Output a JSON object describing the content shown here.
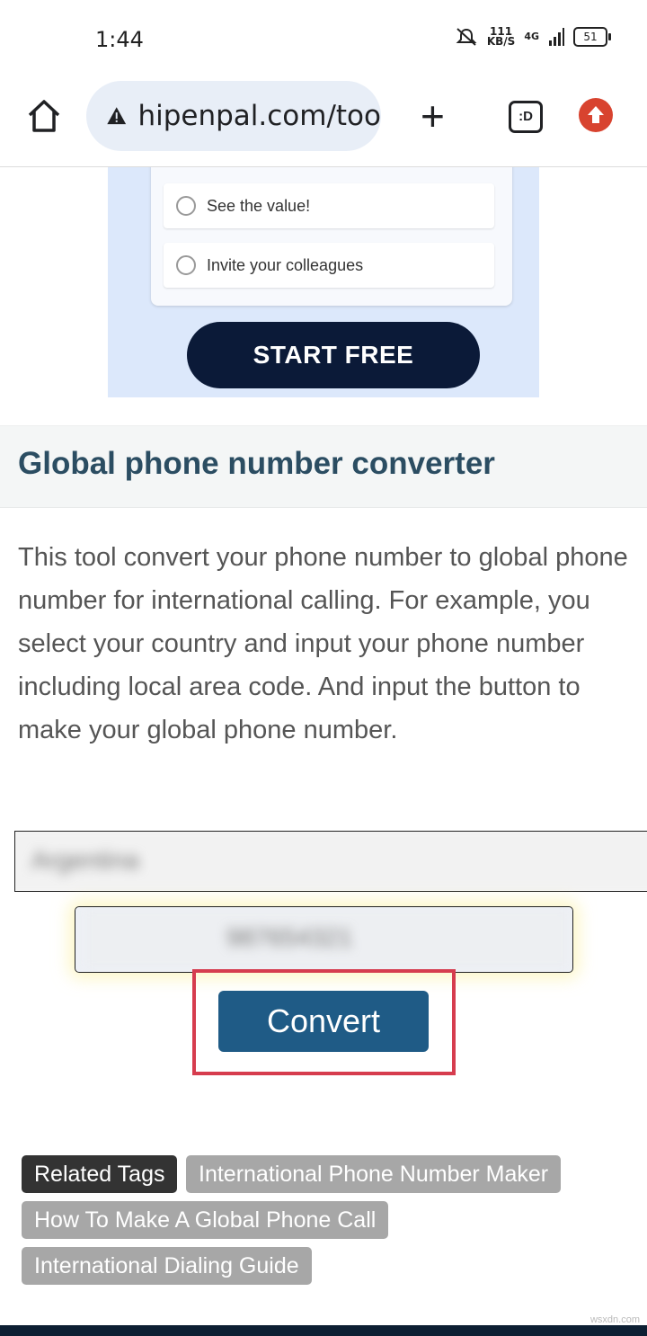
{
  "status": {
    "time": "1:44",
    "speed": "111",
    "speed_unit": "KB/S",
    "network": "4G",
    "battery": "51"
  },
  "browser": {
    "url": "hipenpal.com/too"
  },
  "ad": {
    "option1": "See the value!",
    "option2": "Invite your colleagues",
    "cta": "START FREE"
  },
  "page": {
    "title": "Global phone number converter",
    "description": "This tool convert your phone number to global phone number for international calling. For example, you select your country and input your phone number including local area code. And input the button to make your global phone number."
  },
  "form": {
    "country": "Argentina",
    "phone": "987654321",
    "convert_label": "Convert"
  },
  "tags": [
    {
      "label": "Related Tags"
    },
    {
      "label": "International Phone Number Maker"
    },
    {
      "label": "How To Make A Global Phone Call"
    },
    {
      "label": "International Dialing Guide"
    }
  ],
  "watermark": "wsxdn.com"
}
